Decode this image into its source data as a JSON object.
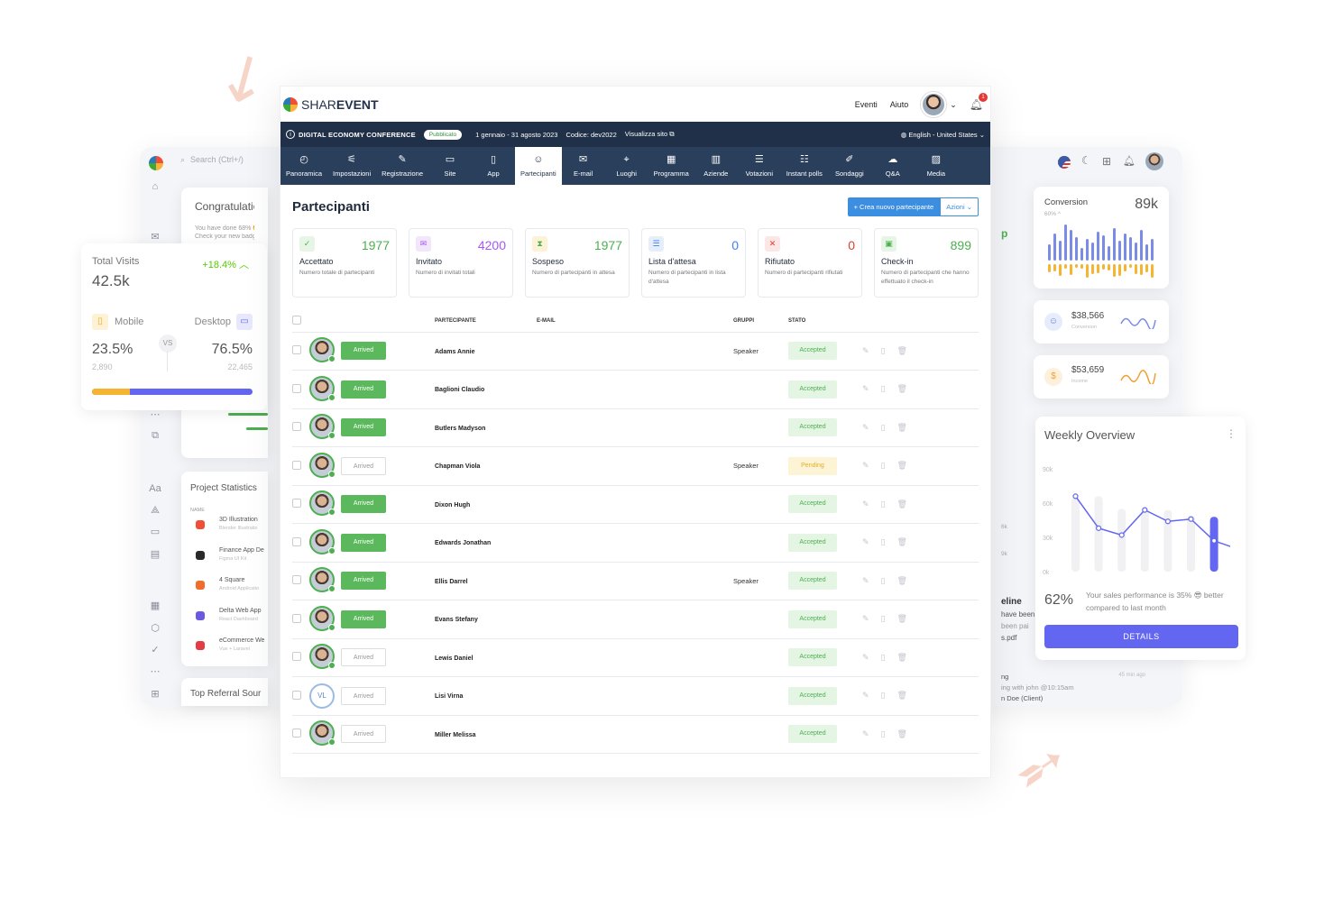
{
  "background": {
    "search_placeholder": "Search (Ctrl+/)",
    "congrats": {
      "title": "Congratulatio",
      "line1": "You have done 68% 🤩",
      "line2": "Check your new badge"
    },
    "project_stats": {
      "title": "Project Statistics",
      "col_name": "NAME",
      "items": [
        {
          "name": "3D Illustration",
          "sub": "Blender Illustratio",
          "color": "#f04e37"
        },
        {
          "name": "Finance App De",
          "sub": "Figma UI Kit",
          "color": "#2a2a2a"
        },
        {
          "name": "4 Square",
          "sub": "Android Applicatio",
          "color": "#f06d2b"
        },
        {
          "name": "Delta Web App",
          "sub": "React Dashboard",
          "color": "#6a5ae0"
        },
        {
          "name": "eCommerce We",
          "sub": "Vue + Laravel",
          "color": "#e23c45"
        }
      ]
    },
    "referral": "Top Referral Sour",
    "conversion": {
      "title": "Conversion",
      "value": "89k",
      "pct": "60%"
    },
    "revenue": {
      "value": "$38,566",
      "label": "Conversion"
    },
    "income": {
      "value": "$53,659",
      "label": "Income"
    },
    "timeline": {
      "title": "eline",
      "l1": "have been",
      "l2": "been pai",
      "file": "s.pdf",
      "l3": "ng",
      "time": "45 min ago",
      "l4": "ing with john @10:15am",
      "client": "n Doe (Client)",
      "k1": "6k",
      "k2": "9k"
    }
  },
  "total_visits": {
    "title": "Total Visits",
    "change": "+18.4%",
    "value": "42.5k",
    "mobile": {
      "label": "Mobile",
      "pct": "23.5%",
      "count": "2,890"
    },
    "desktop": {
      "label": "Desktop",
      "pct": "76.5%",
      "count": "22,465"
    },
    "vs": "VS",
    "mobile_share": 0.235
  },
  "weekly": {
    "title": "Weekly Overview",
    "y_ticks": [
      "90k",
      "60k",
      "30k",
      "0k"
    ],
    "line_values": [
      66,
      38,
      32,
      54,
      44,
      46,
      27,
      20
    ],
    "bar_values": [
      65,
      66,
      55,
      54,
      54,
      49,
      48,
      40
    ],
    "highlight_index": 6,
    "pct": "62%",
    "text": "Your sales performance is 35% 😎 better compared to last month",
    "button": "DETAILS",
    "accent": "#6366f1"
  },
  "app": {
    "brand_share": "SHAR",
    "brand_event": "EVENT",
    "nav": {
      "events": "Eventi",
      "help": "Aiuto",
      "notifications": "1"
    },
    "event": {
      "title": "DIGITAL ECONOMY CONFERENCE",
      "badge": "Pubblicato",
      "dates": "1 gennaio - 31 agosto 2023",
      "code": "Codice: dev2022",
      "visit": "Visualizza sito",
      "language": "English - United States"
    },
    "tabs": [
      {
        "label": "Panoramica",
        "icon": "◴"
      },
      {
        "label": "Impostazioni",
        "icon": "⚟"
      },
      {
        "label": "Registrazione",
        "icon": "✎"
      },
      {
        "label": "Site",
        "icon": "▭"
      },
      {
        "label": "App",
        "icon": "▯"
      },
      {
        "label": "Partecipanti",
        "icon": "☺"
      },
      {
        "label": "E-mail",
        "icon": "✉"
      },
      {
        "label": "Luoghi",
        "icon": "⌖"
      },
      {
        "label": "Programma",
        "icon": "▦"
      },
      {
        "label": "Aziende",
        "icon": "▥"
      },
      {
        "label": "Votazioni",
        "icon": "☰"
      },
      {
        "label": "Instant polls",
        "icon": "☷"
      },
      {
        "label": "Sondaggi",
        "icon": "✐"
      },
      {
        "label": "Q&A",
        "icon": "☁"
      },
      {
        "label": "Media",
        "icon": "▨"
      }
    ],
    "active_tab": 5,
    "page_title": "Partecipanti",
    "btn_new": "+ Crea nuovo partecipante",
    "btn_actions": "Azioni",
    "stats": [
      {
        "label": "Accettato",
        "value": "1977",
        "desc": "Numero totale di partecipanti",
        "color": "#4caf50",
        "bg": "#e6f5e6",
        "icon": "✓"
      },
      {
        "label": "Invitato",
        "value": "4200",
        "desc": "Numero di invitati totali",
        "color": "#a855f7",
        "bg": "#f1e6fb",
        "icon": "✉"
      },
      {
        "label": "Sospeso",
        "value": "1977",
        "desc": "Numero di partecipanti in attesa",
        "color": "#4caf50",
        "bg": "#fdf1d6",
        "icon": "⧗"
      },
      {
        "label": "Lista d'attesa",
        "value": "0",
        "desc": "Numero di partecipanti in lista d'attesa",
        "color": "#3b82f6",
        "bg": "#e6eefc",
        "icon": "☰"
      },
      {
        "label": "Rifiutato",
        "value": "0",
        "desc": "Numero di partecipanti rifiutati",
        "color": "#e53935",
        "bg": "#fde6e6",
        "icon": "✕"
      },
      {
        "label": "Check-in",
        "value": "899",
        "desc": "Numero di partecipanti che hanno effettuato il check-in",
        "color": "#4caf50",
        "bg": "#e6f5e6",
        "icon": "▣"
      }
    ],
    "columns": {
      "participant": "PARTECIPANTE",
      "email": "E-MAIL",
      "groups": "GRUPPI",
      "status": "STATO"
    },
    "rows": [
      {
        "arrived": "Arrived",
        "arrived_on": true,
        "name": "Adams Annie",
        "group": "Speaker",
        "status": "Accepted",
        "state": "acc"
      },
      {
        "arrived": "Arrived",
        "arrived_on": true,
        "name": "Baglioni Claudio",
        "group": "",
        "status": "Accepted",
        "state": "acc"
      },
      {
        "arrived": "Arrived",
        "arrived_on": true,
        "name": "Butlers Madyson",
        "group": "",
        "status": "Accepted",
        "state": "acc"
      },
      {
        "arrived": "Arrived",
        "arrived_on": false,
        "name": "Chapman Viola",
        "group": "Speaker",
        "status": "Pending",
        "state": "pen"
      },
      {
        "arrived": "Arrived",
        "arrived_on": true,
        "name": "Dixon Hugh",
        "group": "",
        "status": "Accepted",
        "state": "acc"
      },
      {
        "arrived": "Arrived",
        "arrived_on": true,
        "name": "Edwards Jonathan",
        "group": "",
        "status": "Accepted",
        "state": "acc"
      },
      {
        "arrived": "Arrived",
        "arrived_on": true,
        "name": "Ellis Darrel",
        "group": "Speaker",
        "status": "Accepted",
        "state": "acc"
      },
      {
        "arrived": "Arrived",
        "arrived_on": true,
        "name": "Evans Stefany",
        "group": "",
        "status": "Accepted",
        "state": "acc"
      },
      {
        "arrived": "Arrived",
        "arrived_on": false,
        "name": "Lewis Daniel",
        "group": "",
        "status": "Accepted",
        "state": "acc"
      },
      {
        "arrived": "Arrived",
        "arrived_on": false,
        "name": "Lisi Virna",
        "group": "",
        "status": "Accepted",
        "state": "acc",
        "initials": "VL"
      },
      {
        "arrived": "Arrived",
        "arrived_on": false,
        "name": "Miller Melissa",
        "group": "",
        "status": "Accepted",
        "state": "acc"
      }
    ]
  }
}
